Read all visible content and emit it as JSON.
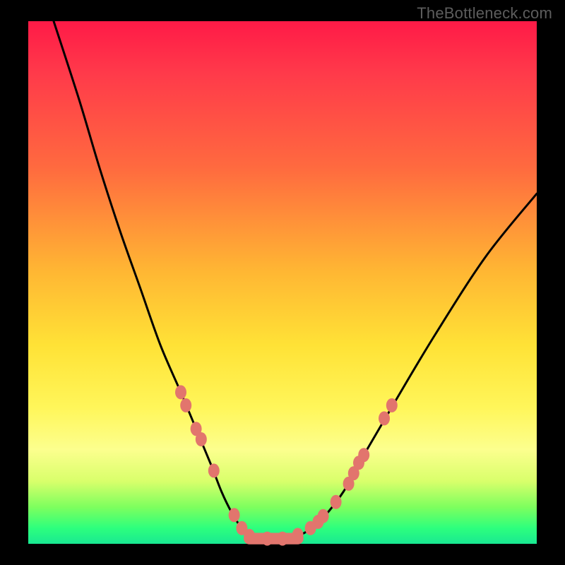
{
  "watermark": "TheBottleneck.com",
  "chart_data": {
    "type": "line",
    "title": "",
    "xlabel": "",
    "ylabel": "",
    "xlim": [
      0,
      100
    ],
    "ylim": [
      0,
      100
    ],
    "grid": false,
    "legend": false,
    "series": [
      {
        "name": "bottleneck-curve",
        "x": [
          5,
          10,
          14,
          18,
          22,
          26,
          30,
          33,
          36,
          38,
          40,
          42,
          44,
          46,
          48,
          52,
          55,
          58,
          62,
          66,
          72,
          80,
          90,
          100
        ],
        "y": [
          100,
          85,
          72,
          60,
          49,
          38,
          29,
          22,
          15,
          10,
          6,
          3,
          1.5,
          1,
          1,
          1.2,
          2.5,
          5,
          10,
          17,
          27,
          40,
          55,
          67
        ]
      }
    ],
    "markers": {
      "name": "highlighted-points",
      "color": "#e2756d",
      "points": [
        {
          "x": 30.0,
          "y": 29.0
        },
        {
          "x": 31.0,
          "y": 26.5
        },
        {
          "x": 33.0,
          "y": 22.0
        },
        {
          "x": 34.0,
          "y": 20.0
        },
        {
          "x": 36.5,
          "y": 14.0
        },
        {
          "x": 40.5,
          "y": 5.5
        },
        {
          "x": 42.0,
          "y": 3.0
        },
        {
          "x": 43.5,
          "y": 1.5
        },
        {
          "x": 47.0,
          "y": 1.0
        },
        {
          "x": 50.0,
          "y": 1.0
        },
        {
          "x": 53.0,
          "y": 1.7
        },
        {
          "x": 55.5,
          "y": 3.0
        },
        {
          "x": 57.0,
          "y": 4.2
        },
        {
          "x": 58.0,
          "y": 5.3
        },
        {
          "x": 60.5,
          "y": 8.0
        },
        {
          "x": 63.0,
          "y": 11.5
        },
        {
          "x": 64.0,
          "y": 13.5
        },
        {
          "x": 65.0,
          "y": 15.5
        },
        {
          "x": 66.0,
          "y": 17.0
        },
        {
          "x": 70.0,
          "y": 24.0
        },
        {
          "x": 71.5,
          "y": 26.5
        }
      ]
    },
    "trough_band": {
      "name": "flat-trough",
      "color": "#e2756d",
      "x_start": 43.5,
      "x_end": 53.0,
      "y": 1.0,
      "thickness": 2.2
    }
  }
}
